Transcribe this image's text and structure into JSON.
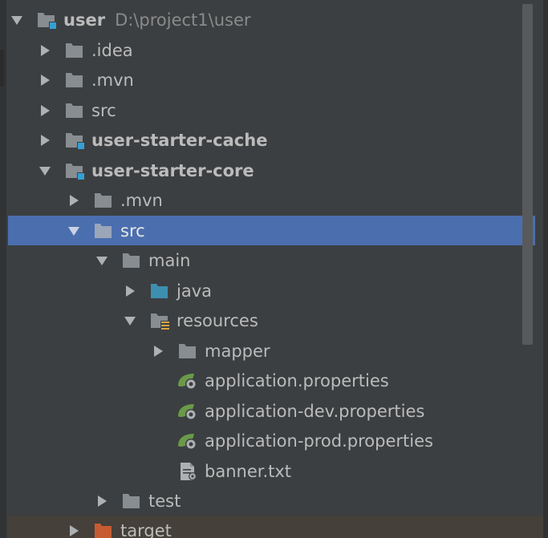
{
  "tree": {
    "root": {
      "label": "user",
      "path": "D:\\project1\\user"
    },
    "items": [
      {
        "label": ".idea"
      },
      {
        "label": ".mvn"
      },
      {
        "label": "src"
      },
      {
        "label": "user-starter-cache"
      },
      {
        "label": "user-starter-core"
      },
      {
        "label": ".mvn"
      },
      {
        "label": "src"
      },
      {
        "label": "main"
      },
      {
        "label": "java"
      },
      {
        "label": "resources"
      },
      {
        "label": "mapper"
      },
      {
        "label": "application.properties"
      },
      {
        "label": "application-dev.properties"
      },
      {
        "label": "application-prod.properties"
      },
      {
        "label": "banner.txt"
      },
      {
        "label": "test"
      },
      {
        "label": "target"
      }
    ]
  },
  "colors": {
    "background": "#3c3f41",
    "selection": "#4b6eaf",
    "folder": "#878d91",
    "source_folder": "#3d8fb0",
    "excluded_folder": "#c75b31",
    "spring": "#6a9a48"
  }
}
